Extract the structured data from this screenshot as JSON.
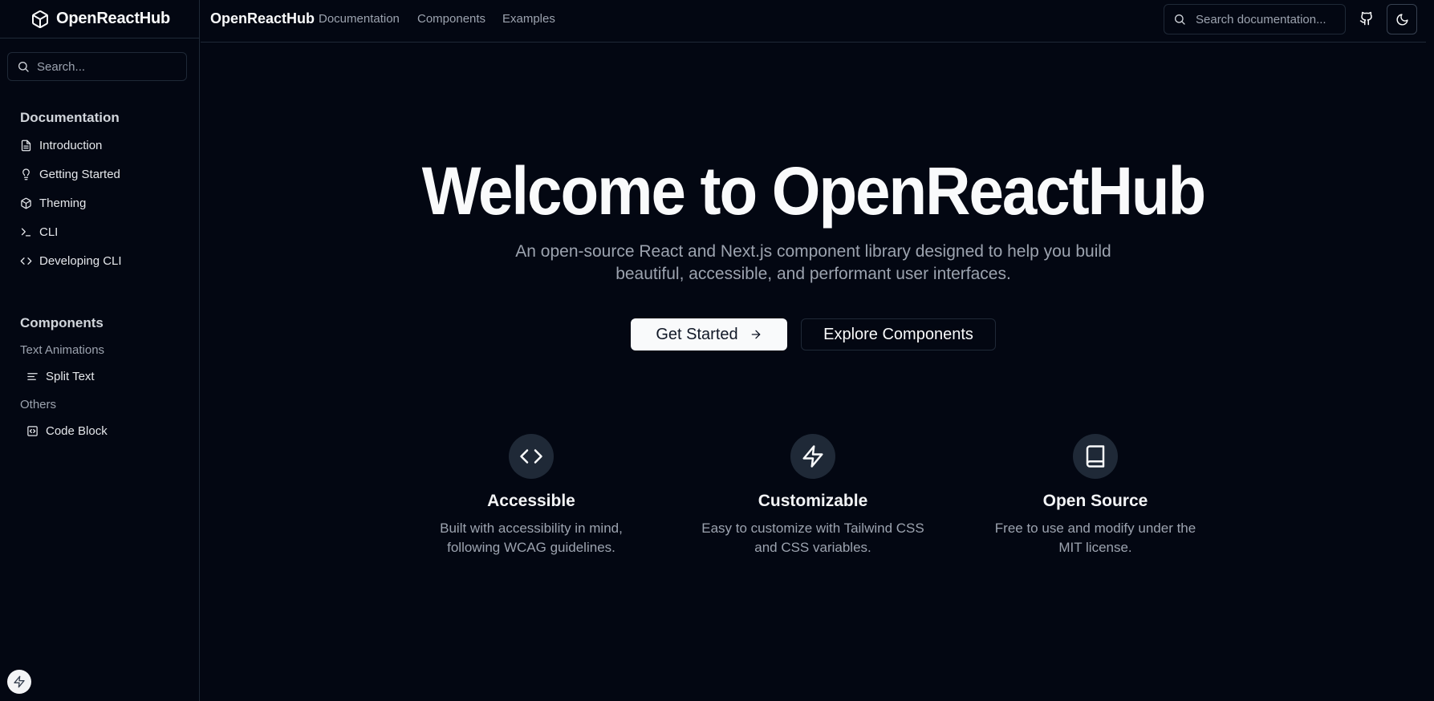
{
  "brand": {
    "name": "OpenReactHub",
    "logo_icon": "package-icon"
  },
  "sidebar": {
    "search_placeholder": "Search...",
    "sections": [
      {
        "title": "Documentation",
        "items": [
          {
            "label": "Introduction",
            "icon": "file-text-icon"
          },
          {
            "label": "Getting Started",
            "icon": "lightbulb-icon"
          },
          {
            "label": "Theming",
            "icon": "package-icon"
          },
          {
            "label": "CLI",
            "icon": "terminal-icon"
          },
          {
            "label": "Developing CLI",
            "icon": "code-icon"
          }
        ]
      },
      {
        "title": "Components",
        "groups": [
          {
            "label": "Text Animations",
            "items": [
              {
                "label": "Split Text",
                "icon": "align-left-icon"
              }
            ]
          },
          {
            "label": "Others",
            "items": [
              {
                "label": "Code Block",
                "icon": "file-code-icon"
              }
            ]
          }
        ]
      }
    ]
  },
  "topnav": {
    "brand": "OpenReactHub",
    "links": [
      "Documentation",
      "Components",
      "Examples"
    ],
    "search_placeholder": "Search documentation...",
    "github_icon": "github-icon",
    "theme_icon": "moon-icon"
  },
  "hero": {
    "title": "Welcome to OpenReactHub",
    "subtitle": "An open-source React and Next.js component library designed to help you build beautiful, accessible, and performant user interfaces.",
    "primary_button": "Get Started",
    "secondary_button": "Explore Components"
  },
  "features": [
    {
      "title": "Accessible",
      "description": "Built with accessibility in mind, following WCAG guidelines.",
      "icon": "code-icon"
    },
    {
      "title": "Customizable",
      "description": "Easy to customize with Tailwind CSS and CSS variables.",
      "icon": "zap-icon"
    },
    {
      "title": "Open Source",
      "description": "Free to use and modify under the MIT license.",
      "icon": "book-icon"
    }
  ],
  "colors": {
    "background": "#030712",
    "border": "#1f2937",
    "text": "#f9fafb",
    "muted": "#9ca3af",
    "icon_bg": "#1f2937"
  }
}
